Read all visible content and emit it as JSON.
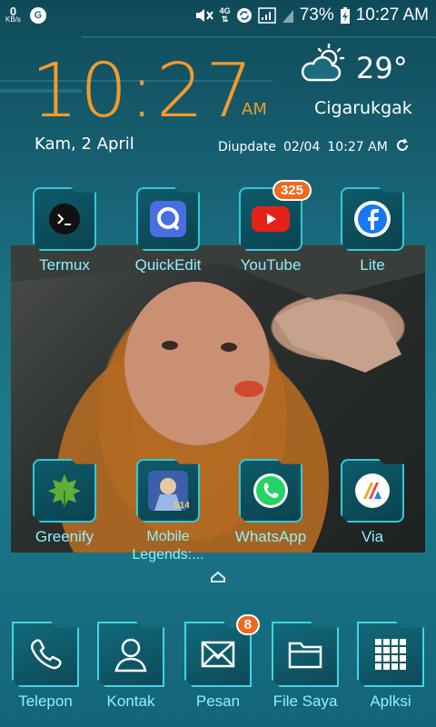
{
  "statusbar": {
    "net_speed": "0",
    "net_unit": "KB/s",
    "network": "4G",
    "battery": "73%",
    "time": "10:27 AM"
  },
  "widget": {
    "clock": "10:27",
    "ampm": "AM",
    "date": "Kam, 2 April",
    "temperature": "29°",
    "location": "Cigarukgak",
    "updated_label": "Diupdate",
    "updated_date": "02/04",
    "updated_time": "10:27 AM"
  },
  "apps": [
    {
      "label": "Termux",
      "icon": "termux-icon"
    },
    {
      "label": "QuickEdit",
      "icon": "quickedit-icon"
    },
    {
      "label": "YouTube",
      "icon": "youtube-icon",
      "badge": "325"
    },
    {
      "label": "Lite",
      "icon": "facebook-lite-icon"
    },
    {
      "label": "Greenify",
      "icon": "greenify-icon"
    },
    {
      "label": "Mobile Legends:...",
      "icon": "mobile-legends-icon"
    },
    {
      "label": "WhatsApp",
      "icon": "whatsapp-icon"
    },
    {
      "label": "Via",
      "icon": "via-browser-icon"
    }
  ],
  "dock": [
    {
      "label": "Telepon",
      "icon": "phone-icon"
    },
    {
      "label": "Kontak",
      "icon": "contacts-icon"
    },
    {
      "label": "Pesan",
      "icon": "messages-icon",
      "badge": "8"
    },
    {
      "label": "File Saya",
      "icon": "folder-icon"
    },
    {
      "label": "Aplksi",
      "icon": "apps-grid-icon"
    }
  ],
  "colors": {
    "accent": "#f29a2a",
    "label": "#8ff0ff",
    "tile_border": "#36c7d8",
    "badge": "#ef6a1d"
  }
}
